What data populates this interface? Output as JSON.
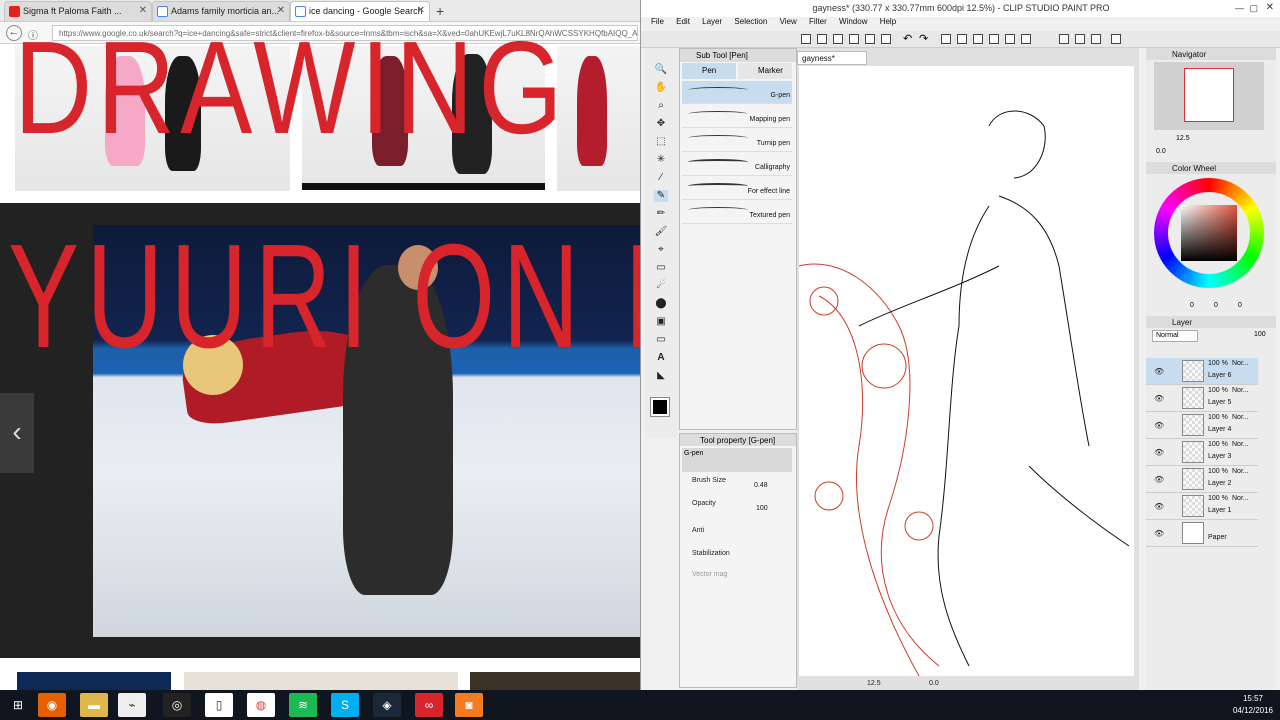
{
  "browser": {
    "tabs": [
      {
        "label": "Sigma ft Paloma Faith ...",
        "color": "#e62117"
      },
      {
        "label": "Adams family morticia an...",
        "color": "#4285f4"
      },
      {
        "label": "ice dancing - Google Search",
        "color": "#4285f4"
      }
    ],
    "url": "https://www.google.co.uk/search?q=ice+dancing&safe=strict&client=firefox-b&source=lnms&tbm=isch&sa=X&ved=0ahUKEwjL7uKL8NrQAhWCSSYKHQfbAIQQ_A",
    "overlay_line1": "DRAWING",
    "overlay_line2": "YUURI ON ICE"
  },
  "csp": {
    "title": "gayness* (330.77 x 330.77mm 600dpi 12.5%) - CLIP STUDIO PAINT PRO",
    "menu": [
      "File",
      "Edit",
      "Layer",
      "Selection",
      "View",
      "Filter",
      "Window",
      "Help"
    ],
    "subtool_title": "Sub Tool [Pen]",
    "subtool_tabs": [
      "Pen",
      "Marker"
    ],
    "pens": [
      "G-pen",
      "Mapping pen",
      "Turnip pen",
      "Calligraphy",
      "For effect line",
      "Textured pen"
    ],
    "toolprop_title": "Tool property [G-pen]",
    "toolprop_name": "G-pen",
    "brush_size_label": "Brush Size",
    "brush_size_value": "0.48",
    "opacity_label": "Opacity",
    "opacity_value": "100",
    "anti_label": "Anti",
    "stabilization_label": "Stabilization",
    "vector_label": "Vector mag",
    "doc_tab": "gayness*",
    "zoom": "12.5",
    "rotation": "0.0",
    "navigator_title": "Navigator",
    "nav_zoom": "12.5",
    "nav_rotation": "0.0",
    "colorwheel_title": "Color Wheel",
    "color_values": [
      "0",
      "0",
      "0"
    ],
    "layer_title": "Layer",
    "blend_mode": "Normal",
    "layer_opacity": "100",
    "layers": [
      {
        "name": "Layer 6",
        "pct": "100 %",
        "mode": "Nor..."
      },
      {
        "name": "Layer 5",
        "pct": "100 %",
        "mode": "Nor..."
      },
      {
        "name": "Layer 4",
        "pct": "100 %",
        "mode": "Nor..."
      },
      {
        "name": "Layer 3",
        "pct": "100 %",
        "mode": "Nor..."
      },
      {
        "name": "Layer 2",
        "pct": "100 %",
        "mode": "Nor..."
      },
      {
        "name": "Layer 1",
        "pct": "100 %",
        "mode": "Nor..."
      },
      {
        "name": "Paper",
        "pct": "",
        "mode": ""
      }
    ]
  },
  "taskbar": {
    "time": "15:57",
    "date": "04/12/2016"
  },
  "colors": {
    "accent_red": "#d8242b",
    "wheel_base": "#e25540"
  }
}
